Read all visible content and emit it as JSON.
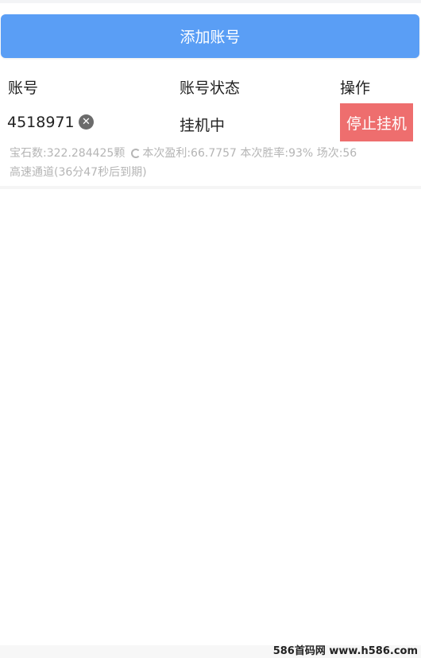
{
  "header": {
    "add_account_label": "添加账号"
  },
  "table": {
    "columns": [
      "账号",
      "账号状态",
      "操作"
    ]
  },
  "account": {
    "id": "4518971",
    "status": "挂机中",
    "stop_label": "停止挂机",
    "stats_gems": "宝石数:322.284425颗",
    "stats_session": "本次盈利:66.7757 本次胜率:93% 场次:56",
    "channel": "高速通道(36分47秒后到期)"
  },
  "watermark": "586首码网 www.h586.com",
  "colors": {
    "primary": "#5a9ef5",
    "danger": "#ee6e6e",
    "muted_text": "#b5b5b5"
  },
  "icons": {
    "remove": "close-circle-icon",
    "refresh": "refresh-icon"
  }
}
